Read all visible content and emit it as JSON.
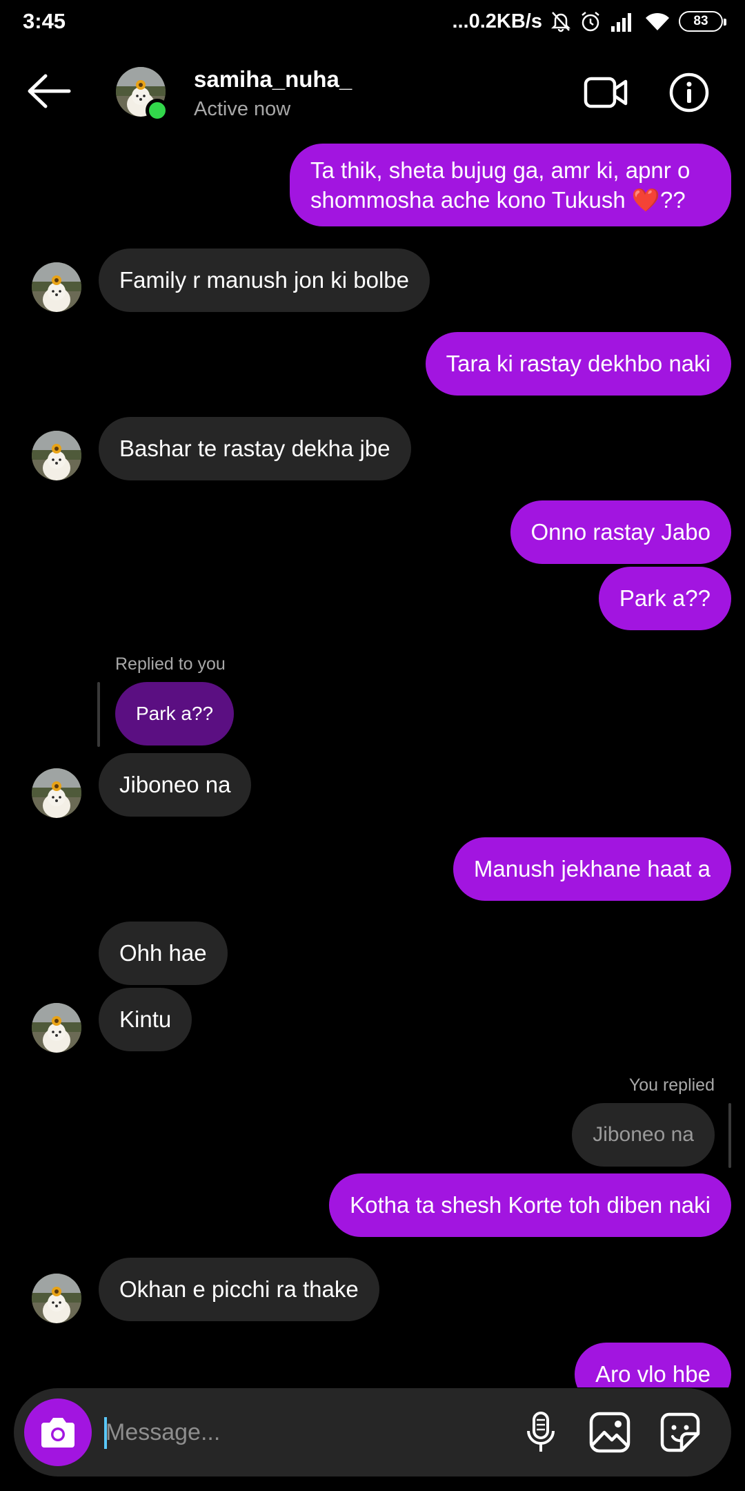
{
  "status_bar": {
    "time": "3:45",
    "network_speed": "...0.2KB/s",
    "battery": "83"
  },
  "header": {
    "username": "samiha_nuha_",
    "status": "Active now"
  },
  "messages": [
    {
      "from": "me",
      "text": "Ta thik, sheta bujug ga, amr ki, apnr o shommosha ache kono Tukush ❤️??"
    },
    {
      "from": "them",
      "text": "Family r manush jon ki bolbe"
    },
    {
      "from": "me",
      "text": "Tara ki rastay dekhbo naki"
    },
    {
      "from": "them",
      "text": "Bashar te rastay dekha jbe"
    },
    {
      "from": "me",
      "text": "Onno rastay Jabo"
    },
    {
      "from": "me",
      "text": "Park a??"
    },
    {
      "from": "them",
      "text": "Jiboneo na",
      "reply_label": "Replied to you",
      "reply_quote": "Park a??"
    },
    {
      "from": "me",
      "text": "Manush jekhane haat a"
    },
    {
      "from": "them",
      "text": "Ohh hae"
    },
    {
      "from": "them",
      "text": "Kintu"
    },
    {
      "from": "me",
      "text": "Kotha ta shesh Korte toh diben naki",
      "reply_label": "You replied",
      "reply_quote": "Jiboneo na"
    },
    {
      "from": "them",
      "text": "Okhan e picchi ra thake"
    },
    {
      "from": "me",
      "text": "Aro vlo hbe"
    }
  ],
  "composer": {
    "placeholder": "Message..."
  },
  "colors": {
    "outgoing_bubble": "#a215e0",
    "incoming_bubble": "#262626",
    "online": "#32d74b",
    "background": "#000000"
  },
  "icons": [
    "back-arrow-icon",
    "video-call-icon",
    "info-icon",
    "camera-icon",
    "microphone-icon",
    "gallery-icon",
    "sticker-icon"
  ]
}
